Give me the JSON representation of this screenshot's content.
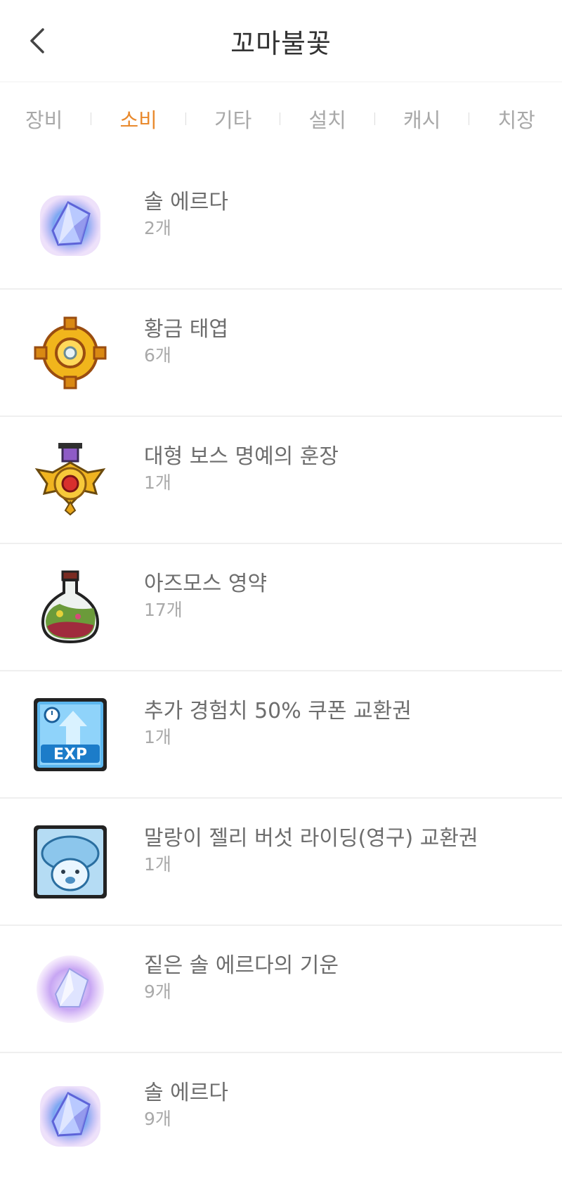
{
  "header": {
    "title": "꼬마불꽃",
    "back_icon": "chevron-left-icon"
  },
  "tabs": [
    {
      "label": "장비"
    },
    {
      "label": "소비",
      "active": true
    },
    {
      "label": "기타"
    },
    {
      "label": "설치"
    },
    {
      "label": "캐시"
    },
    {
      "label": "치장"
    }
  ],
  "colors": {
    "accent": "#e98a2e",
    "text": "#6d6d6d",
    "muted": "#a9a9a9",
    "divider": "#efefef"
  },
  "items": [
    {
      "name": "솔 에르다",
      "count": "2개",
      "icon": "sol-erda-icon"
    },
    {
      "name": "황금 태엽",
      "count": "6개",
      "icon": "golden-gear-icon"
    },
    {
      "name": "대형 보스 명예의 훈장",
      "count": "1개",
      "icon": "boss-medal-icon"
    },
    {
      "name": "아즈모스 영약",
      "count": "17개",
      "icon": "potion-flask-icon"
    },
    {
      "name": "추가 경험치 50% 쿠폰 교환권",
      "count": "1개",
      "icon": "exp-coupon-icon"
    },
    {
      "name": "말랑이 젤리 버섯 라이딩(영구) 교환권",
      "count": "1개",
      "icon": "jelly-mushroom-icon"
    },
    {
      "name": "짙은 솔 에르다의 기운",
      "count": "9개",
      "icon": "sol-erda-aura-icon"
    },
    {
      "name": "솔 에르다",
      "count": "9개",
      "icon": "sol-erda-icon"
    }
  ]
}
